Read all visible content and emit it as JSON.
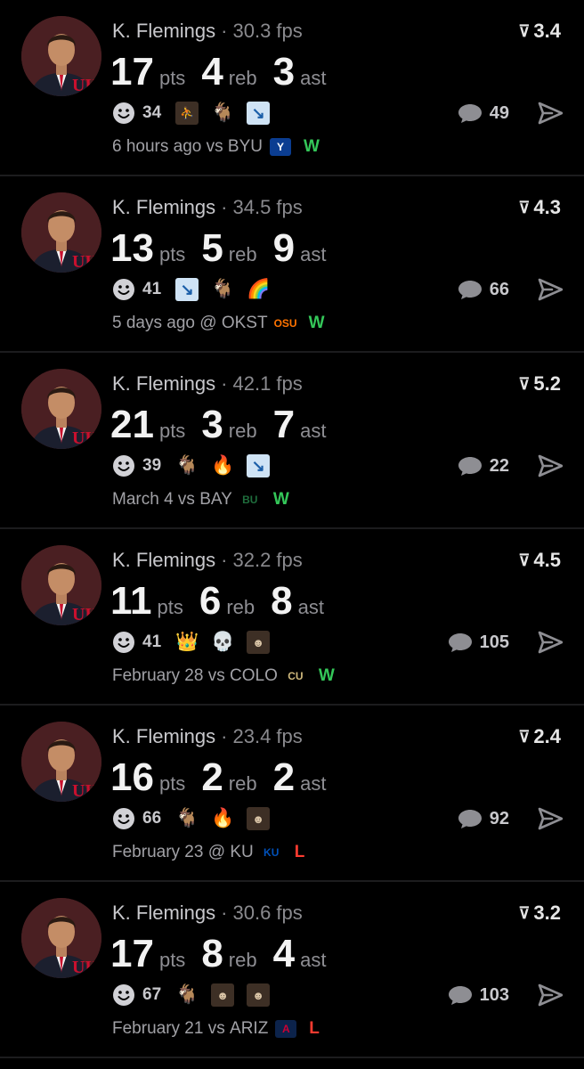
{
  "colors": {
    "win": "#34c759",
    "loss": "#ff3b30"
  },
  "cards": [
    {
      "player": "K. Flemings",
      "fps": "30.3 fps",
      "score": "3.4",
      "stats": [
        {
          "num": "17",
          "label": "pts"
        },
        {
          "num": "4",
          "label": "reb"
        },
        {
          "num": "3",
          "label": "ast"
        }
      ],
      "reaction_count": "34",
      "reactions": [
        {
          "icon": "player-photo-icon",
          "glyph": "⛹",
          "kind": "photo"
        },
        {
          "icon": "goat-icon",
          "glyph": "🐐",
          "kind": "plain"
        },
        {
          "icon": "chart-decreasing-icon",
          "glyph": "↘",
          "kind": "graph"
        }
      ],
      "comments": "49",
      "time": "6 hours ago",
      "prep": "vs",
      "opponent": "BYU",
      "logo": {
        "icon": "byu-logo-icon",
        "text": "Y",
        "bg": "#0b3d91",
        "fg": "#ffffff"
      },
      "result": "W",
      "result_kind": "win"
    },
    {
      "player": "K. Flemings",
      "fps": "34.5 fps",
      "score": "4.3",
      "stats": [
        {
          "num": "13",
          "label": "pts"
        },
        {
          "num": "5",
          "label": "reb"
        },
        {
          "num": "9",
          "label": "ast"
        }
      ],
      "reaction_count": "41",
      "reactions": [
        {
          "icon": "chart-decreasing-icon",
          "glyph": "↘",
          "kind": "graph"
        },
        {
          "icon": "goat-icon",
          "glyph": "🐐",
          "kind": "plain"
        },
        {
          "icon": "rainbow-icon",
          "glyph": "🌈",
          "kind": "plain"
        }
      ],
      "comments": "66",
      "time": "5 days ago",
      "prep": "@",
      "opponent": "OKST",
      "logo": {
        "icon": "okst-logo-icon",
        "text": "OSU",
        "bg": "transparent",
        "fg": "#ff7300"
      },
      "result": "W",
      "result_kind": "win"
    },
    {
      "player": "K. Flemings",
      "fps": "42.1 fps",
      "score": "5.2",
      "stats": [
        {
          "num": "21",
          "label": "pts"
        },
        {
          "num": "3",
          "label": "reb"
        },
        {
          "num": "7",
          "label": "ast"
        }
      ],
      "reaction_count": "39",
      "reactions": [
        {
          "icon": "goat-icon",
          "glyph": "🐐",
          "kind": "plain"
        },
        {
          "icon": "fire-icon",
          "glyph": "🔥",
          "kind": "plain"
        },
        {
          "icon": "chart-decreasing-icon",
          "glyph": "↘",
          "kind": "graph"
        }
      ],
      "comments": "22",
      "time": "March 4",
      "prep": "vs",
      "opponent": "BAY",
      "logo": {
        "icon": "baylor-logo-icon",
        "text": "BU",
        "bg": "transparent",
        "fg": "#1f6e3d"
      },
      "result": "W",
      "result_kind": "win"
    },
    {
      "player": "K. Flemings",
      "fps": "32.2 fps",
      "score": "4.5",
      "stats": [
        {
          "num": "11",
          "label": "pts"
        },
        {
          "num": "6",
          "label": "reb"
        },
        {
          "num": "8",
          "label": "ast"
        }
      ],
      "reaction_count": "41",
      "reactions": [
        {
          "icon": "crown-icon",
          "glyph": "👑",
          "kind": "plain"
        },
        {
          "icon": "skull-icon",
          "glyph": "💀",
          "kind": "plain"
        },
        {
          "icon": "person-photo-icon",
          "glyph": "☻",
          "kind": "photo"
        }
      ],
      "comments": "105",
      "time": "February 28",
      "prep": "vs",
      "opponent": "COLO",
      "logo": {
        "icon": "colorado-logo-icon",
        "text": "CU",
        "bg": "transparent",
        "fg": "#cfb87c"
      },
      "result": "W",
      "result_kind": "win"
    },
    {
      "player": "K. Flemings",
      "fps": "23.4 fps",
      "score": "2.4",
      "stats": [
        {
          "num": "16",
          "label": "pts"
        },
        {
          "num": "2",
          "label": "reb"
        },
        {
          "num": "2",
          "label": "ast"
        }
      ],
      "reaction_count": "66",
      "reactions": [
        {
          "icon": "goat-icon",
          "glyph": "🐐",
          "kind": "plain"
        },
        {
          "icon": "fire-icon",
          "glyph": "🔥",
          "kind": "plain"
        },
        {
          "icon": "person-photo-icon",
          "glyph": "☻",
          "kind": "photo"
        }
      ],
      "comments": "92",
      "time": "February 23",
      "prep": "@",
      "opponent": "KU",
      "logo": {
        "icon": "jayhawk-logo-icon",
        "text": "KU",
        "bg": "transparent",
        "fg": "#0051ba"
      },
      "result": "L",
      "result_kind": "loss"
    },
    {
      "player": "K. Flemings",
      "fps": "30.6 fps",
      "score": "3.2",
      "stats": [
        {
          "num": "17",
          "label": "pts"
        },
        {
          "num": "8",
          "label": "reb"
        },
        {
          "num": "4",
          "label": "ast"
        }
      ],
      "reaction_count": "67",
      "reactions": [
        {
          "icon": "goat-icon",
          "glyph": "🐐",
          "kind": "plain"
        },
        {
          "icon": "person-photo-icon",
          "glyph": "☻",
          "kind": "photo"
        },
        {
          "icon": "person-photo-icon",
          "glyph": "☻",
          "kind": "photo"
        }
      ],
      "comments": "103",
      "time": "February 21",
      "prep": "vs",
      "opponent": "ARIZ",
      "logo": {
        "icon": "arizona-logo-icon",
        "text": "A",
        "bg": "#0c234b",
        "fg": "#cc0033"
      },
      "result": "L",
      "result_kind": "loss"
    }
  ]
}
